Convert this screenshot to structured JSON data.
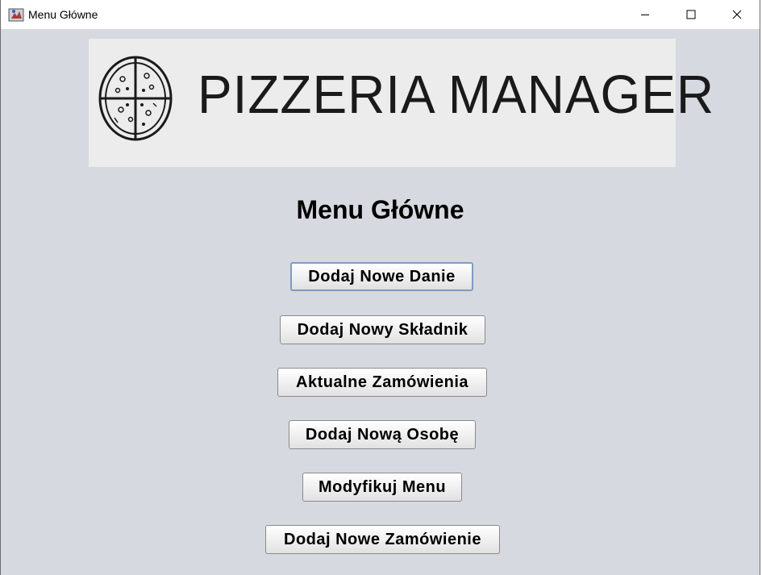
{
  "window": {
    "title": "Menu Główne",
    "controls": {
      "minimize_icon": "minimize-icon",
      "maximize_icon": "maximize-icon",
      "close_icon": "close-icon"
    }
  },
  "banner": {
    "text": "PIZZERIA MANAGER",
    "logo_icon": "pizza-icon"
  },
  "main": {
    "title": "Menu Główne",
    "buttons": [
      {
        "label": "Dodaj Nowe Danie",
        "focused": true
      },
      {
        "label": "Dodaj Nowy Składnik",
        "focused": false
      },
      {
        "label": "Aktualne Zamówienia",
        "focused": false
      },
      {
        "label": "Dodaj Nową Osobę",
        "focused": false
      },
      {
        "label": "Modyfikuj Menu",
        "focused": false
      },
      {
        "label": "Dodaj Nowe Zamówienie",
        "focused": false
      }
    ]
  },
  "colors": {
    "background": "#d6d9e0",
    "titlebar": "#ffffff",
    "focus_border": "#7c9cc4"
  }
}
